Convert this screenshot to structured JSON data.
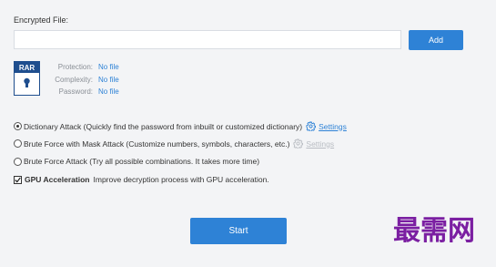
{
  "form": {
    "encrypted_file_label": "Encrypted File:",
    "file_input_value": "",
    "add_button": "Add"
  },
  "file_info": {
    "badge": "RAR",
    "rows": [
      {
        "key": "Protection:",
        "value": "No file"
      },
      {
        "key": "Complexity:",
        "value": "No file"
      },
      {
        "key": "Password:",
        "value": "No file"
      }
    ]
  },
  "options": {
    "dictionary": {
      "label": "Dictionary Attack (Quickly find the password from inbuilt or customized dictionary)",
      "selected": true,
      "settings": "Settings"
    },
    "mask": {
      "label": "Brute Force with Mask Attack (Customize numbers, symbols, characters, etc.)",
      "selected": false,
      "settings": "Settings"
    },
    "brute": {
      "label": "Brute Force Attack (Try all possible combinations. It takes more time)",
      "selected": false
    },
    "gpu": {
      "title": "GPU Acceleration",
      "desc": "Improve decryption process with GPU acceleration.",
      "checked": true
    }
  },
  "start_button": "Start",
  "watermark": "最需网",
  "colors": {
    "accent": "#2e82d6",
    "rar_badge": "#1f4e8e",
    "watermark": "#7b1fa2"
  }
}
